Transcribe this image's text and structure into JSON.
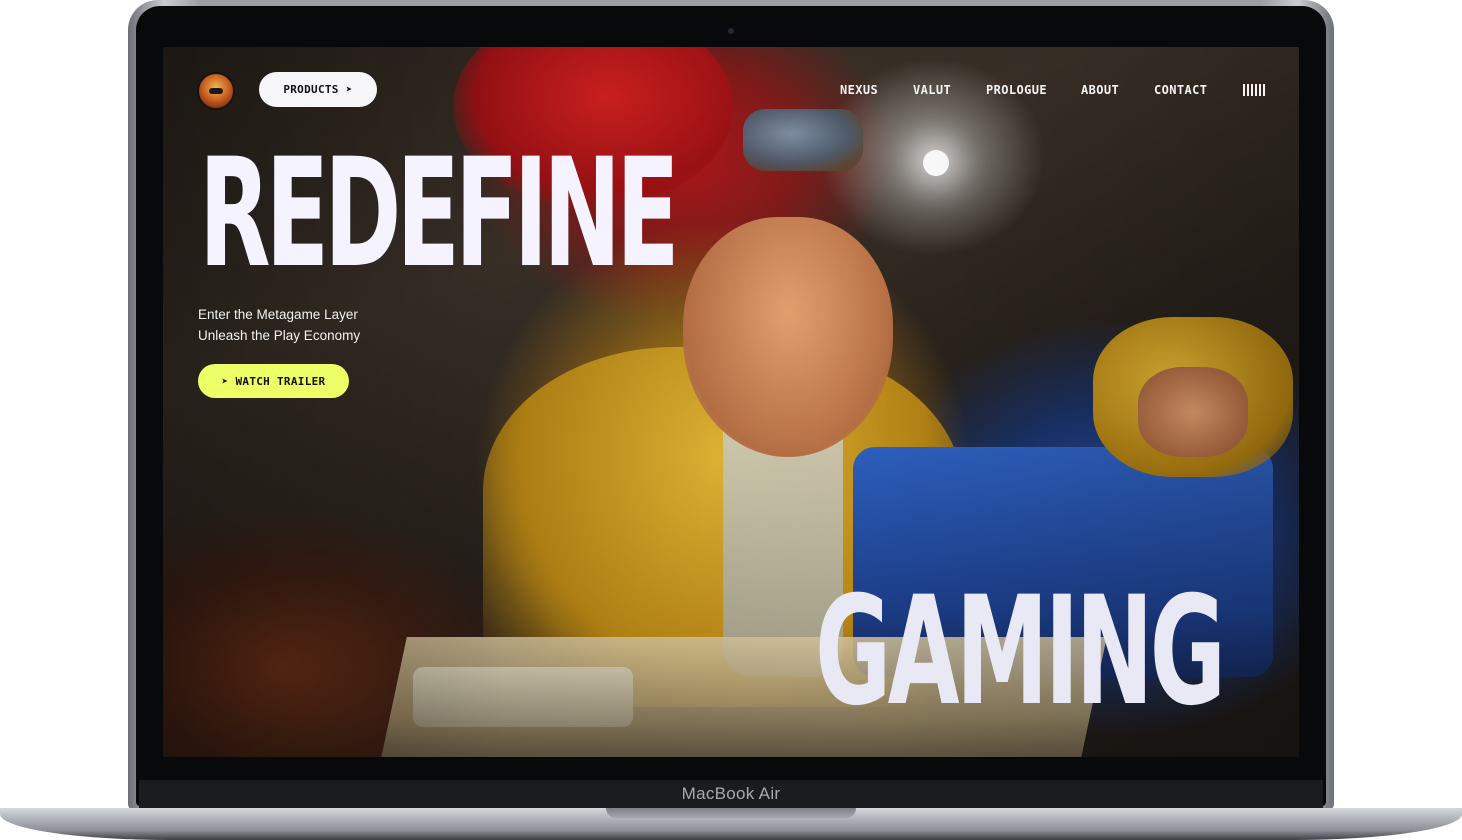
{
  "device": {
    "label": "MacBook Air"
  },
  "header": {
    "products_label": "PRODUCTS",
    "nav": [
      "NEXUS",
      "VALUT",
      "PROLOGUE",
      "ABOUT",
      "CONTACT"
    ]
  },
  "hero": {
    "title": "REDEFINE",
    "subtitle_lines": [
      "Enter the Metagame Layer",
      "Unleash the Play Economy"
    ],
    "cta_label": "WATCH TRAILER",
    "word_bottom": "GAMING"
  },
  "colors": {
    "accent": "#edff66",
    "title": "#f4f3ff",
    "pill": "#f6f6f8"
  },
  "icons": {
    "logo": "mascot-logo",
    "products_arrow": "navigation-arrow-icon",
    "menu": "audio-bars-icon"
  }
}
